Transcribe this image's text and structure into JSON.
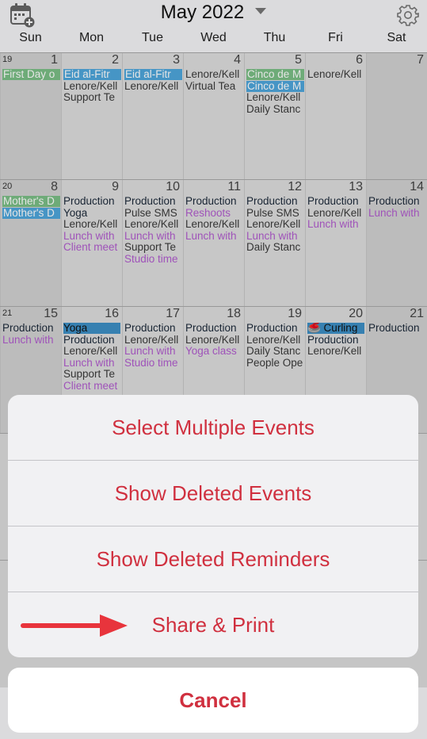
{
  "header": {
    "month_title": "May 2022",
    "weekdays": [
      "Sun",
      "Mon",
      "Tue",
      "Wed",
      "Thu",
      "Fri",
      "Sat"
    ]
  },
  "weeks": [
    {
      "week_number": "19",
      "days": [
        {
          "num": "1",
          "events": [
            {
              "t": "First Day o",
              "s": "banner green"
            }
          ]
        },
        {
          "num": "2",
          "events": [
            {
              "t": "Eid al-Fitr",
              "s": "banner blue"
            },
            {
              "t": "Lenore/Kell",
              "s": ""
            },
            {
              "t": "Support Te",
              "s": ""
            }
          ]
        },
        {
          "num": "3",
          "events": [
            {
              "t": "Eid al-Fitr",
              "s": "banner blue"
            },
            {
              "t": "Lenore/Kell",
              "s": ""
            }
          ]
        },
        {
          "num": "4",
          "events": [
            {
              "t": "Lenore/Kell",
              "s": ""
            },
            {
              "t": "Virtual Tea",
              "s": ""
            }
          ]
        },
        {
          "num": "5",
          "events": [
            {
              "t": "Cinco de M",
              "s": "banner green"
            },
            {
              "t": "Cinco de M",
              "s": "banner blue"
            },
            {
              "t": "Lenore/Kell",
              "s": ""
            },
            {
              "t": "Daily Stanc",
              "s": ""
            }
          ]
        },
        {
          "num": "6",
          "events": [
            {
              "t": "Lenore/Kell",
              "s": ""
            }
          ]
        },
        {
          "num": "7",
          "events": []
        }
      ]
    },
    {
      "week_number": "20",
      "days": [
        {
          "num": "8",
          "events": [
            {
              "t": "Mother's D",
              "s": "banner green"
            },
            {
              "t": "Mother's D",
              "s": "banner blue"
            }
          ]
        },
        {
          "num": "9",
          "events": [
            {
              "t": "Production",
              "s": "dark"
            },
            {
              "t": "Yoga",
              "s": "dark"
            },
            {
              "t": "Lenore/Kell",
              "s": ""
            },
            {
              "t": "Lunch with",
              "s": "purple"
            },
            {
              "t": "Client meet",
              "s": "purple"
            }
          ]
        },
        {
          "num": "10",
          "events": [
            {
              "t": "Production",
              "s": "dark"
            },
            {
              "t": "Pulse SMS",
              "s": ""
            },
            {
              "t": "Lenore/Kell",
              "s": ""
            },
            {
              "t": "Lunch with",
              "s": "purple"
            },
            {
              "t": "Support Te",
              "s": ""
            },
            {
              "t": "Studio time",
              "s": "purple"
            }
          ]
        },
        {
          "num": "11",
          "events": [
            {
              "t": "Production",
              "s": "dark"
            },
            {
              "t": "Reshoots",
              "s": "purple"
            },
            {
              "t": "Lenore/Kell",
              "s": ""
            },
            {
              "t": "Lunch with",
              "s": "purple"
            }
          ]
        },
        {
          "num": "12",
          "events": [
            {
              "t": "Production",
              "s": "dark"
            },
            {
              "t": "Pulse SMS",
              "s": ""
            },
            {
              "t": "Lenore/Kell",
              "s": ""
            },
            {
              "t": "Lunch with",
              "s": "purple"
            },
            {
              "t": "Daily Stanc",
              "s": ""
            }
          ]
        },
        {
          "num": "13",
          "events": [
            {
              "t": "Production",
              "s": "dark"
            },
            {
              "t": "Lenore/Kell",
              "s": ""
            },
            {
              "t": "Lunch with",
              "s": "purple"
            }
          ]
        },
        {
          "num": "14",
          "events": [
            {
              "t": "Production",
              "s": "dark"
            },
            {
              "t": "Lunch with",
              "s": "purple"
            }
          ]
        }
      ]
    },
    {
      "week_number": "21",
      "days": [
        {
          "num": "15",
          "events": [
            {
              "t": "Production",
              "s": "dark"
            },
            {
              "t": "Lunch with",
              "s": "purple"
            }
          ]
        },
        {
          "num": "16",
          "events": [
            {
              "t": "Yoga",
              "s": "yoga"
            },
            {
              "t": "Production",
              "s": "dark"
            },
            {
              "t": "Lenore/Kell",
              "s": ""
            },
            {
              "t": "Lunch with",
              "s": "purple"
            },
            {
              "t": "Support Te",
              "s": ""
            },
            {
              "t": "Client meet",
              "s": "purple"
            }
          ]
        },
        {
          "num": "17",
          "events": [
            {
              "t": "Production",
              "s": "dark"
            },
            {
              "t": "Lenore/Kell",
              "s": ""
            },
            {
              "t": "Lunch with",
              "s": "purple"
            },
            {
              "t": "Studio time",
              "s": "purple"
            }
          ]
        },
        {
          "num": "18",
          "events": [
            {
              "t": "Production",
              "s": "dark"
            },
            {
              "t": "Lenore/Kell",
              "s": ""
            },
            {
              "t": "Yoga class",
              "s": "purple"
            }
          ]
        },
        {
          "num": "19",
          "events": [
            {
              "t": "Production",
              "s": "dark"
            },
            {
              "t": "Lenore/Kell",
              "s": ""
            },
            {
              "t": "Daily Stanc",
              "s": ""
            },
            {
              "t": "People Ope",
              "s": ""
            }
          ]
        },
        {
          "num": "20",
          "events": [
            {
              "t": "🥌 Curling",
              "s": "yoga"
            },
            {
              "t": "Production",
              "s": "dark"
            },
            {
              "t": "Lenore/Kell",
              "s": ""
            }
          ]
        },
        {
          "num": "21",
          "events": [
            {
              "t": "Production",
              "s": "dark"
            }
          ]
        }
      ]
    }
  ],
  "action_sheet": {
    "items": [
      "Select Multiple Events",
      "Show Deleted Events",
      "Show Deleted Reminders",
      "Share & Print"
    ],
    "cancel_label": "Cancel"
  },
  "colors": {
    "accent_red": "#d0303f",
    "arrow_red": "#e8343c"
  }
}
